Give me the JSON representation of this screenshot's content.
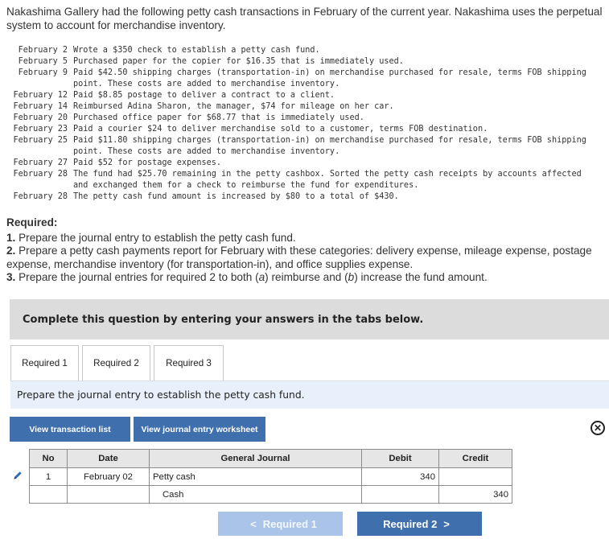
{
  "intro": "Nakashima Gallery had the following petty cash transactions in February of the current year. Nakashima uses the perpetual system to account for merchandise inventory.",
  "transactions": [
    {
      "date": "February 2",
      "text": "Wrote a $350 check to establish a petty cash fund."
    },
    {
      "date": "February 5",
      "text": "Purchased paper for the copier for $16.35 that is immediately used."
    },
    {
      "date": "February 9",
      "text": "Paid $42.50 shipping charges (transportation-in) on merchandise purchased for resale, terms FOB shipping point. These costs are added to merchandise inventory."
    },
    {
      "date": "February 12",
      "text": "Paid $8.85 postage to deliver a contract to a client."
    },
    {
      "date": "February 14",
      "text": "Reimbursed Adina Sharon, the manager, $74 for mileage on her car."
    },
    {
      "date": "February 20",
      "text": "Purchased office paper for $68.77 that is immediately used."
    },
    {
      "date": "February 23",
      "text": "Paid a courier $24 to deliver merchandise sold to a customer, terms FOB destination."
    },
    {
      "date": "February 25",
      "text": "Paid $11.80 shipping charges (transportation-in) on merchandise purchased for resale, terms FOB shipping point. These costs are added to merchandise inventory."
    },
    {
      "date": "February 27",
      "text": "Paid $52 for postage expenses."
    },
    {
      "date": "February 28",
      "text": "The fund had $25.70 remaining in the petty cashbox. Sorted the petty cash receipts by accounts affected and exchanged them for a check to reimburse the fund for expenditures."
    },
    {
      "date": "February 28",
      "text": "The petty cash fund amount is increased by $80 to a total of $430."
    }
  ],
  "required": {
    "heading": "Required:",
    "items": [
      {
        "num": "1.",
        "text": " Prepare the journal entry to establish the petty cash fund."
      },
      {
        "num": "2.",
        "text": " Prepare a petty cash payments report for February with these categories: delivery expense, mileage expense, postage expense, merchandise inventory (for transportation-in), and office supplies expense."
      },
      {
        "num": "3.",
        "text_pre": " Prepare the journal entries for required 2 to both (",
        "a": "a",
        "text_mid": ") reimburse and (",
        "b": "b",
        "text_post": ") increase the fund amount."
      }
    ]
  },
  "banner": "Complete this question by entering your answers in the tabs below.",
  "tabs": [
    "Required 1",
    "Required 2",
    "Required 3"
  ],
  "instruction": "Prepare the journal entry to establish the petty cash fund.",
  "buttons": {
    "view_transactions": "View transaction list",
    "view_worksheet": "View journal entry worksheet",
    "prev": "Required 1",
    "next": "Required 2"
  },
  "journal": {
    "headers": {
      "no": "No",
      "date": "Date",
      "general_journal": "General Journal",
      "debit": "Debit",
      "credit": "Credit"
    },
    "rows": [
      {
        "no": "1",
        "date": "February 02",
        "account": "Petty cash",
        "debit": "340",
        "credit": ""
      },
      {
        "no": "",
        "date": "",
        "account": "Cash",
        "debit": "",
        "credit": "340"
      }
    ]
  },
  "icons": {
    "edit": "pencil-icon",
    "close": "close-circle-icon",
    "prev": "chevron-left-icon",
    "next": "chevron-right-icon"
  },
  "colors": {
    "button_blue": "#3f6fad",
    "button_disabled": "#a9c4e8",
    "banner_gray": "#dcdcdc",
    "instruction_bg": "#e8f1fb"
  }
}
